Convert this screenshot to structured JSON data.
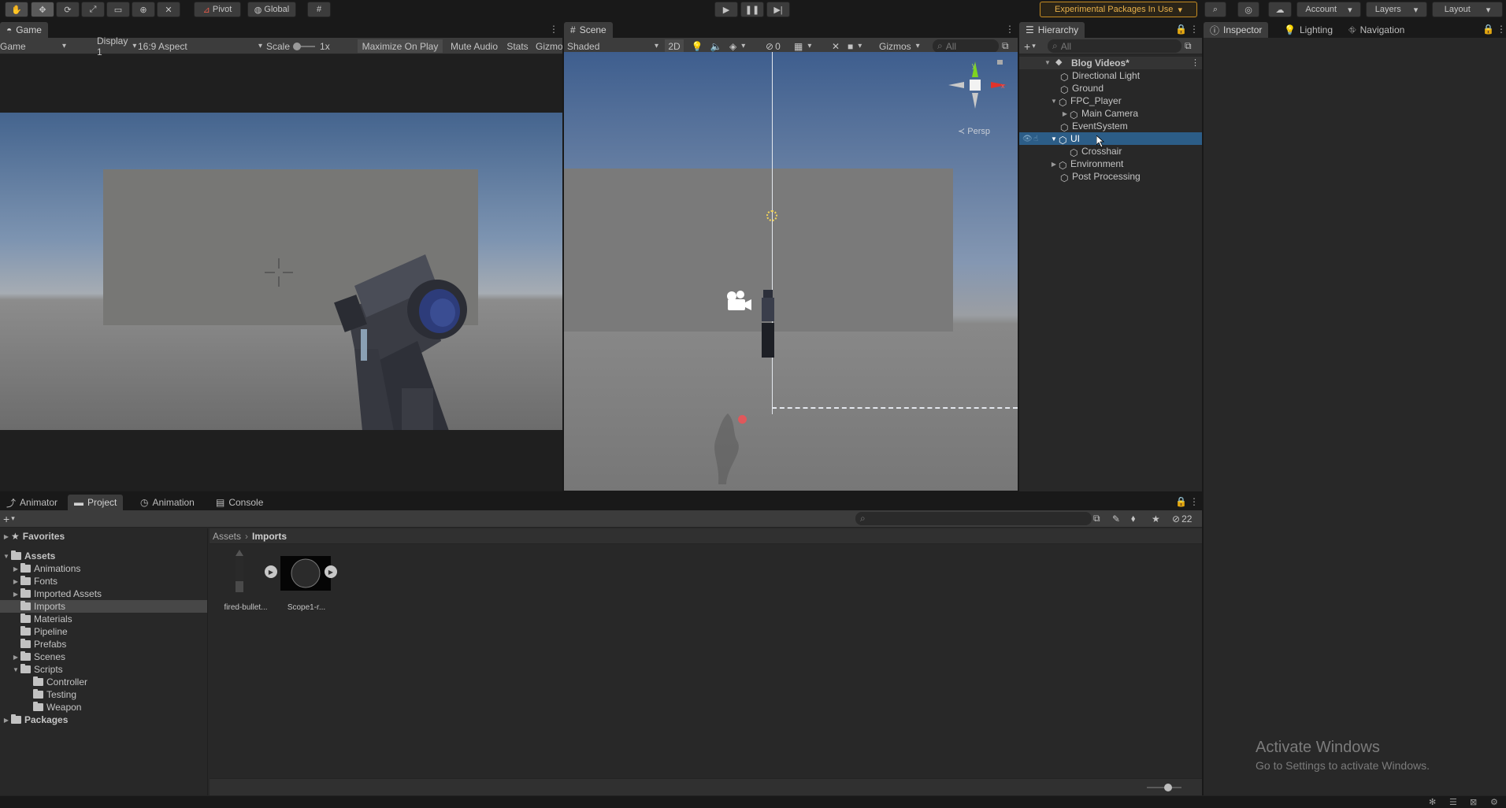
{
  "toolbar": {
    "pivot": "Pivot",
    "global": "Global",
    "experimental": "Experimental Packages In Use",
    "account": "Account",
    "layers": "Layers",
    "layout": "Layout"
  },
  "game": {
    "tab": "Game",
    "mode": "Game",
    "display": "Display 1",
    "aspect": "16:9 Aspect",
    "scale_label": "Scale",
    "scale_value": "1x",
    "maximize": "Maximize On Play",
    "mute": "Mute Audio",
    "stats": "Stats",
    "gizmos": "Gizmos"
  },
  "scene": {
    "tab": "Scene",
    "shading": "Shaded",
    "mode2d": "2D",
    "hidden_count": "0",
    "gizmos": "Gizmos",
    "search_placeholder": "All",
    "persp": "Persp",
    "axis_x": "x",
    "axis_y": "y"
  },
  "hierarchy": {
    "tab": "Hierarchy",
    "search_placeholder": "All",
    "scene_name": "Blog Videos*",
    "items": [
      {
        "label": "Directional Light"
      },
      {
        "label": "Ground"
      },
      {
        "label": "FPC_Player"
      },
      {
        "label": "Main Camera"
      },
      {
        "label": "EventSystem"
      },
      {
        "label": "UI"
      },
      {
        "label": "Crosshair"
      },
      {
        "label": "Environment"
      },
      {
        "label": "Post Processing"
      }
    ]
  },
  "inspector": {
    "tabs": [
      "Inspector",
      "Lighting",
      "Navigation"
    ]
  },
  "bottom": {
    "tabs": [
      "Animator",
      "Project",
      "Animation",
      "Console"
    ],
    "hidden_count": "22"
  },
  "project": {
    "favorites": "Favorites",
    "assets": "Assets",
    "asset_folders": [
      "Animations",
      "Fonts",
      "Imported Assets",
      "Imports",
      "Materials",
      "Pipeline",
      "Prefabs",
      "Scenes",
      "Scripts"
    ],
    "script_folders": [
      "Controller",
      "Testing",
      "Weapon"
    ],
    "packages": "Packages",
    "breadcrumb": [
      "Assets",
      "Imports"
    ],
    "files": [
      {
        "name": "fired-bullet..."
      },
      {
        "name": "Scope1-r..."
      }
    ]
  },
  "watermark": {
    "title": "Activate Windows",
    "subtitle": "Go to Settings to activate Windows."
  },
  "colors": {
    "selection": "#2c5d87",
    "experimental_border": "#c58b21",
    "panel": "#282828",
    "toolbar": "#191919"
  }
}
